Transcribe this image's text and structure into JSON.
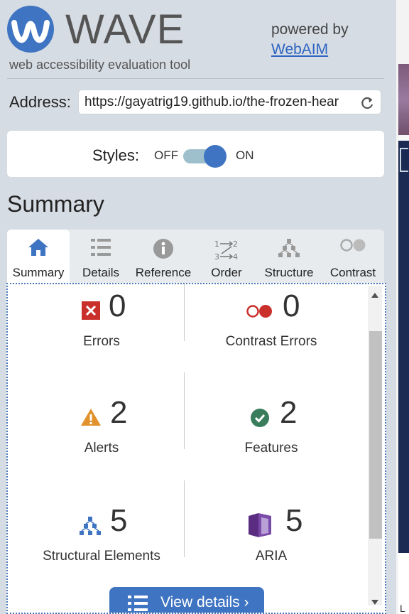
{
  "header": {
    "app_title": "WAVE",
    "tagline": "web accessibility evaluation tool",
    "powered_by": "powered by",
    "webaim_link": "WebAIM"
  },
  "address": {
    "label": "Address:",
    "value": "https://gayatrig19.github.io/the-frozen-hear"
  },
  "styles": {
    "label": "Styles:",
    "off_label": "OFF",
    "on_label": "ON",
    "state": "on"
  },
  "summary": {
    "heading": "Summary",
    "tabs": [
      {
        "label": "Summary",
        "icon": "home-icon",
        "active": true
      },
      {
        "label": "Details",
        "icon": "list-icon"
      },
      {
        "label": "Reference",
        "icon": "info-icon"
      },
      {
        "label": "Order",
        "icon": "order-icon"
      },
      {
        "label": "Structure",
        "icon": "structure-icon"
      },
      {
        "label": "Contrast",
        "icon": "contrast-icon"
      }
    ],
    "metrics": [
      {
        "label": "Errors",
        "count": "0",
        "icon": "error-icon",
        "color": "#c9302c"
      },
      {
        "label": "Contrast Errors",
        "count": "0",
        "icon": "contrast-error-icon",
        "color": "#c9302c"
      },
      {
        "label": "Alerts",
        "count": "2",
        "icon": "alert-icon",
        "color": "#e1922c"
      },
      {
        "label": "Features",
        "count": "2",
        "icon": "feature-icon",
        "color": "#3a7d5c"
      },
      {
        "label": "Structural Elements",
        "count": "5",
        "icon": "structural-element-icon",
        "color": "#3f74c2"
      },
      {
        "label": "ARIA",
        "count": "5",
        "icon": "aria-icon",
        "color": "#5a2d82"
      }
    ],
    "view_details_label": "View details ›"
  },
  "right_strip": {
    "partial_text": "L"
  },
  "colors": {
    "accent": "#3f74c2",
    "panel_bg": "#d6dce3"
  }
}
